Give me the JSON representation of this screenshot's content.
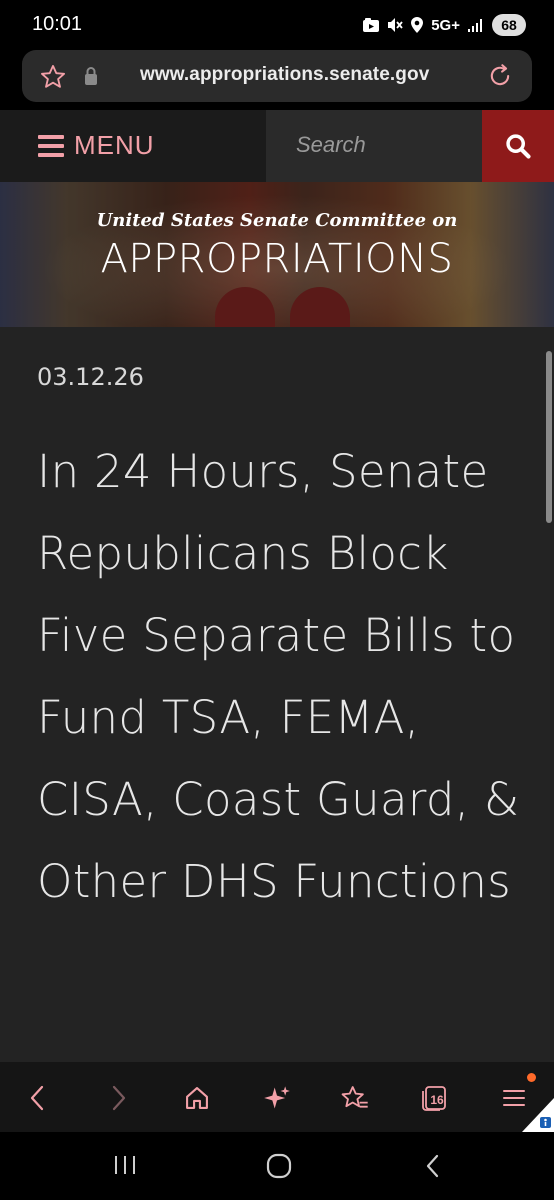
{
  "status_bar": {
    "time": "10:01",
    "network": "5G+",
    "battery": "68",
    "icons": [
      "media-icon",
      "mute-icon",
      "location-icon",
      "signal-icon"
    ]
  },
  "browser": {
    "url": "www.appropriations.senate.gov",
    "tab_count": "16",
    "accent_color": "#f2a0a8"
  },
  "site_nav": {
    "menu_label": "MENU",
    "search_placeholder": "Search",
    "search_button_color": "#8e1a1a"
  },
  "banner": {
    "subtitle": "United States Senate Committee on",
    "title": "APPROPRIATIONS"
  },
  "article": {
    "date": "03.12.26",
    "title": "In 24 Hours, Senate Republicans Block Five Separate Bills to Fund TSA, FEMA, CISA, Coast Guard, & Other DHS Functions"
  }
}
